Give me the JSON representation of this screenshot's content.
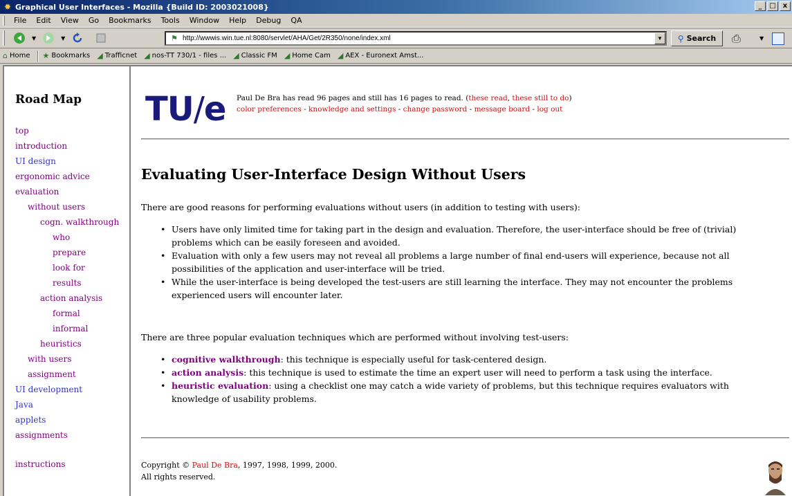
{
  "window": {
    "title": "Graphical User Interfaces - Mozilla {Build ID: 2003021008}",
    "minimize": "_",
    "restore": "□",
    "close": "x"
  },
  "menu": [
    "File",
    "Edit",
    "View",
    "Go",
    "Bookmarks",
    "Tools",
    "Window",
    "Help",
    "Debug",
    "QA"
  ],
  "toolbar": {
    "url": "http://wwwis.win.tue.nl:8080/servlet/AHA/Get/2R350/none/index.xml",
    "search_label": "Search"
  },
  "personal_toolbar": [
    {
      "label": "Home",
      "icon": "home-icon"
    },
    {
      "label": "Bookmarks",
      "icon": "bookmarks-icon"
    },
    {
      "label": "Trafficnet",
      "icon": "link-icon"
    },
    {
      "label": "nos-TT 730/1 - files ...",
      "icon": "link-icon"
    },
    {
      "label": "Classic FM",
      "icon": "link-icon"
    },
    {
      "label": "Home Cam",
      "icon": "link-icon"
    },
    {
      "label": "AEX - Euronext Amst...",
      "icon": "link-icon"
    }
  ],
  "sidebar": {
    "title": "Road Map",
    "items": [
      {
        "label": "top",
        "visited": true
      },
      {
        "label": "introduction",
        "visited": true
      },
      {
        "label": "UI design",
        "visited": false
      },
      {
        "label": "ergonomic advice",
        "visited": true
      },
      {
        "label": "evaluation",
        "visited": true
      },
      {
        "label": "without users",
        "visited": true
      },
      {
        "label": "cogn. walkthrough",
        "visited": true
      },
      {
        "label": "who",
        "visited": true
      },
      {
        "label": "prepare",
        "visited": true
      },
      {
        "label": "look for",
        "visited": true
      },
      {
        "label": "results",
        "visited": true
      },
      {
        "label": "action analysis",
        "visited": true
      },
      {
        "label": "formal",
        "visited": true
      },
      {
        "label": "informal",
        "visited": true
      },
      {
        "label": "heuristics",
        "visited": true
      },
      {
        "label": "with users",
        "visited": true
      },
      {
        "label": "assignment",
        "visited": true
      },
      {
        "label": "UI development",
        "visited": false
      },
      {
        "label": "Java",
        "visited": false
      },
      {
        "label": "applets",
        "visited": false
      },
      {
        "label": "assignments",
        "visited": true
      },
      {
        "label": "instructions",
        "visited": true
      }
    ]
  },
  "header": {
    "logo_tu": "TU",
    "logo_slash": "/",
    "logo_e": "e",
    "status_prefix": "Paul De Bra has read 96 pages and still has 16 pages to read. (",
    "read_link": "these read",
    "status_mid": ", ",
    "todo_link": "these still to do",
    "status_suffix": ")",
    "links": [
      "color preferences",
      "knowledge and settings",
      "change password",
      "message board",
      "log out"
    ],
    "link_sep": " - "
  },
  "article": {
    "title": "Evaluating User-Interface Design Without Users",
    "intro": "There are good reasons for performing evaluations without users (in addition to testing with users):",
    "reasons": [
      "Users have only limited time for taking part in the design and evaluation. Therefore, the user-interface should be free of (trivial) problems which can be easily foreseen and avoided.",
      "Evaluation with only a few users may not reveal all problems a large number of final end-users will experience, because not all possibilities of the application and user-interface will be tried.",
      "While the user-interface is being developed the test-users are still learning the interface. They may not encounter the problems experienced users will encounter later."
    ],
    "techniques_intro": "There are three popular evaluation techniques which are performed without involving test-users:",
    "techniques": [
      {
        "name": "cognitive walkthrough",
        "desc": ": this technique is especially useful for task-centered design."
      },
      {
        "name": "action analysis",
        "desc": ": this technique is used to estimate the time an expert user will need to perform a task using the interface."
      },
      {
        "name": "heuristic evaluation",
        "desc": ": using a checklist one may catch a wide variety of problems, but this technique requires evaluators with knowledge of usability problems."
      }
    ]
  },
  "footer": {
    "copyright_prefix": "Copyright © ",
    "author": "Paul De Bra",
    "years": ", 1997, 1998, 1999, 2000.",
    "rights": "All rights reserved."
  }
}
